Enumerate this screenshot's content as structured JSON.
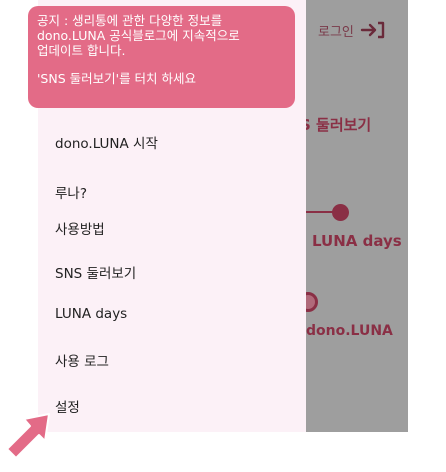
{
  "notice": {
    "line1": "공지 : 생리통에 관한 다양한 정보를",
    "line2": "dono.LUNA 공식블로그에 지속적으로",
    "line3": "업데이트 합니다.",
    "hint": "'SNS 둘러보기'를 터치 하세요"
  },
  "menu": {
    "items": [
      {
        "label": "dono.LUNA 시작"
      },
      {
        "label": "루나?"
      },
      {
        "label": "사용방법"
      },
      {
        "label": "SNS 둘러보기"
      },
      {
        "label": "LUNA days"
      },
      {
        "label": "사용 로그"
      },
      {
        "label": "설정"
      }
    ]
  },
  "background": {
    "login_label": "로그인",
    "sns_partial": "S 둘러보기",
    "luna_days": "LUNA days",
    "dono_partial": "dono.LUNA"
  },
  "icons": {
    "login": "login-arrow-icon",
    "pointer": "pointer-arrow-icon"
  },
  "colors": {
    "accent": "#e36b87",
    "drawer_bg": "#fcf1f7",
    "dim_bg": "#9e9e9e",
    "brand_dark": "#8a2f45"
  }
}
